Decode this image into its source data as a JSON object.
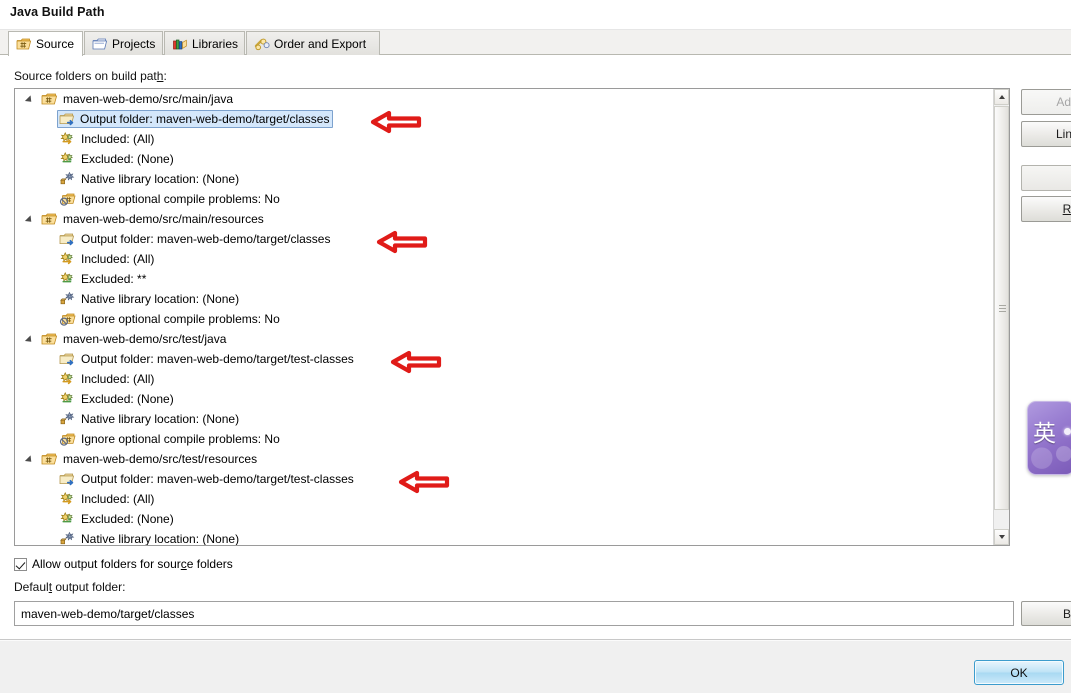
{
  "dialog": {
    "title": "Java Build Path"
  },
  "tabs": [
    {
      "label": "Source",
      "icon": "source-folder-icon",
      "active": true
    },
    {
      "label": "Projects",
      "icon": "projects-icon",
      "active": false
    },
    {
      "label": "Libraries",
      "icon": "libraries-icon",
      "active": false
    },
    {
      "label": "Order and Export",
      "icon": "order-export-icon",
      "active": false
    }
  ],
  "source_section": {
    "label_pre": "Source folders on build pat",
    "label_mnemonic": "h",
    "label_post": ":"
  },
  "tree": [
    {
      "type": "root",
      "icon": "source-folder-icon",
      "label": "maven-web-demo/src/main/java",
      "expanded": true,
      "children": [
        {
          "icon": "output-folder-icon",
          "label": "Output folder: maven-web-demo/target/classes",
          "selected": true,
          "arrow": true
        },
        {
          "icon": "included-icon",
          "label": "Included: (All)",
          "selected": false,
          "arrow": false
        },
        {
          "icon": "excluded-icon",
          "label": "Excluded: (None)",
          "selected": false,
          "arrow": false
        },
        {
          "icon": "native-library-icon",
          "label": "Native library location: (None)",
          "selected": false,
          "arrow": false
        },
        {
          "icon": "ignore-problems-icon",
          "label": "Ignore optional compile problems: No",
          "selected": false,
          "arrow": false
        }
      ]
    },
    {
      "type": "root",
      "icon": "source-folder-icon",
      "label": "maven-web-demo/src/main/resources",
      "expanded": true,
      "children": [
        {
          "icon": "output-folder-icon",
          "label": "Output folder: maven-web-demo/target/classes",
          "selected": false,
          "arrow": true
        },
        {
          "icon": "included-icon",
          "label": "Included: (All)",
          "selected": false,
          "arrow": false
        },
        {
          "icon": "excluded-icon",
          "label": "Excluded: **",
          "selected": false,
          "arrow": false
        },
        {
          "icon": "native-library-icon",
          "label": "Native library location: (None)",
          "selected": false,
          "arrow": false
        },
        {
          "icon": "ignore-problems-icon",
          "label": "Ignore optional compile problems: No",
          "selected": false,
          "arrow": false
        }
      ]
    },
    {
      "type": "root",
      "icon": "source-folder-icon",
      "label": "maven-web-demo/src/test/java",
      "expanded": true,
      "children": [
        {
          "icon": "output-folder-icon",
          "label": "Output folder: maven-web-demo/target/test-classes",
          "selected": false,
          "arrow": true
        },
        {
          "icon": "included-icon",
          "label": "Included: (All)",
          "selected": false,
          "arrow": false
        },
        {
          "icon": "excluded-icon",
          "label": "Excluded: (None)",
          "selected": false,
          "arrow": false
        },
        {
          "icon": "native-library-icon",
          "label": "Native library location: (None)",
          "selected": false,
          "arrow": false
        },
        {
          "icon": "ignore-problems-icon",
          "label": "Ignore optional compile problems: No",
          "selected": false,
          "arrow": false
        }
      ]
    },
    {
      "type": "root",
      "icon": "source-folder-icon",
      "label": "maven-web-demo/src/test/resources",
      "expanded": true,
      "children": [
        {
          "icon": "output-folder-icon",
          "label": "Output folder: maven-web-demo/target/test-classes",
          "selected": false,
          "arrow": true
        },
        {
          "icon": "included-icon",
          "label": "Included: (All)",
          "selected": false,
          "arrow": false
        },
        {
          "icon": "excluded-icon",
          "label": "Excluded: (None)",
          "selected": false,
          "arrow": false
        },
        {
          "icon": "native-library-icon",
          "label": "Native library location: (None)",
          "selected": false,
          "arrow": false
        }
      ]
    }
  ],
  "side_buttons": [
    {
      "label": "Add",
      "state": "disabled"
    },
    {
      "label": "Link",
      "state": "enabled"
    },
    {
      "label": "",
      "state": "enabled"
    },
    {
      "label": "R",
      "state": "enabled"
    }
  ],
  "allow_output_checkbox": {
    "checked": true,
    "label_pre": "Allow output folders for sour",
    "label_mnemonic": "c",
    "label_post": "e folders"
  },
  "default_output": {
    "label_pre": "Defaul",
    "label_mnemonic": "t",
    "label_post": " output folder:",
    "value": "maven-web-demo/target/classes",
    "browse_label": "B"
  },
  "footer": {
    "ok_label": "OK"
  },
  "ime": {
    "mode_char": "英"
  },
  "colors": {
    "selection_bg": "#d4e7fb",
    "selection_border": "#7da2ce",
    "annotation_red": "#e01b18",
    "ok_accent": "#3c9ccd"
  }
}
